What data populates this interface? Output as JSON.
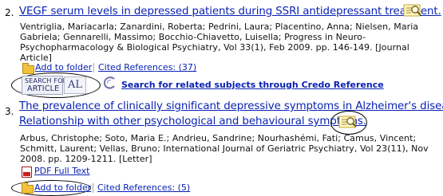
{
  "records": [
    {
      "number": "2.",
      "title": "VEGF serum levels in depressed patients during SSRI antidepressant treatment.",
      "details": [
        "Ventriglia, Mariacarla; Zanardini, Roberta; Pedrini, Laura; Placentino, Anna; Nielsen, Maria",
        "Gabriela; Gennarelli, Massimo; Bocchio-Chiavetto, Luisella; Progress in Neuro-",
        "Psychopharmacology & Biological Psychiatry, Vol 33(1), Feb 2009. pp. 146-149. [Journal",
        "Article]"
      ],
      "add_to_folder": "Add to folder",
      "cited_references": "Cited References: (37)",
      "search_badge": {
        "line1": "SEARCH FOR",
        "line2": "ARTICLE",
        "letters": "AL"
      },
      "credo_link": "Search for related subjects through Credo Reference"
    },
    {
      "number": "3.",
      "title_line1": "The prevalence of clinically significant depressive symptoms in Alzheimer's disease:",
      "title_line2": "Relationship with other psychological and behavioural symptoms.",
      "details": [
        "Arbus, Christophe; Soto, Maria E.; Andrieu, Sandrine; Nourhashémi, Fati; Camus, Vincent;",
        "Schmitt, Laurent; Vellas, Bruno; International Journal of Geriatric Psychiatry, Vol 23(11), Nov",
        "2008. pp. 1209-1211. [Letter]"
      ],
      "pdf_full_text": "PDF Full Text",
      "add_to_folder": "Add to folder",
      "cited_references": "Cited References: (5)"
    }
  ],
  "icons": {
    "preview": "magnifier-preview-icon",
    "folder": "folder-icon",
    "pdf": "pdf-icon",
    "credo": "credo-reference-icon"
  },
  "colors": {
    "link": "#0a22b4",
    "folder": "#f0c23a",
    "pdf": "#c91f1f"
  }
}
